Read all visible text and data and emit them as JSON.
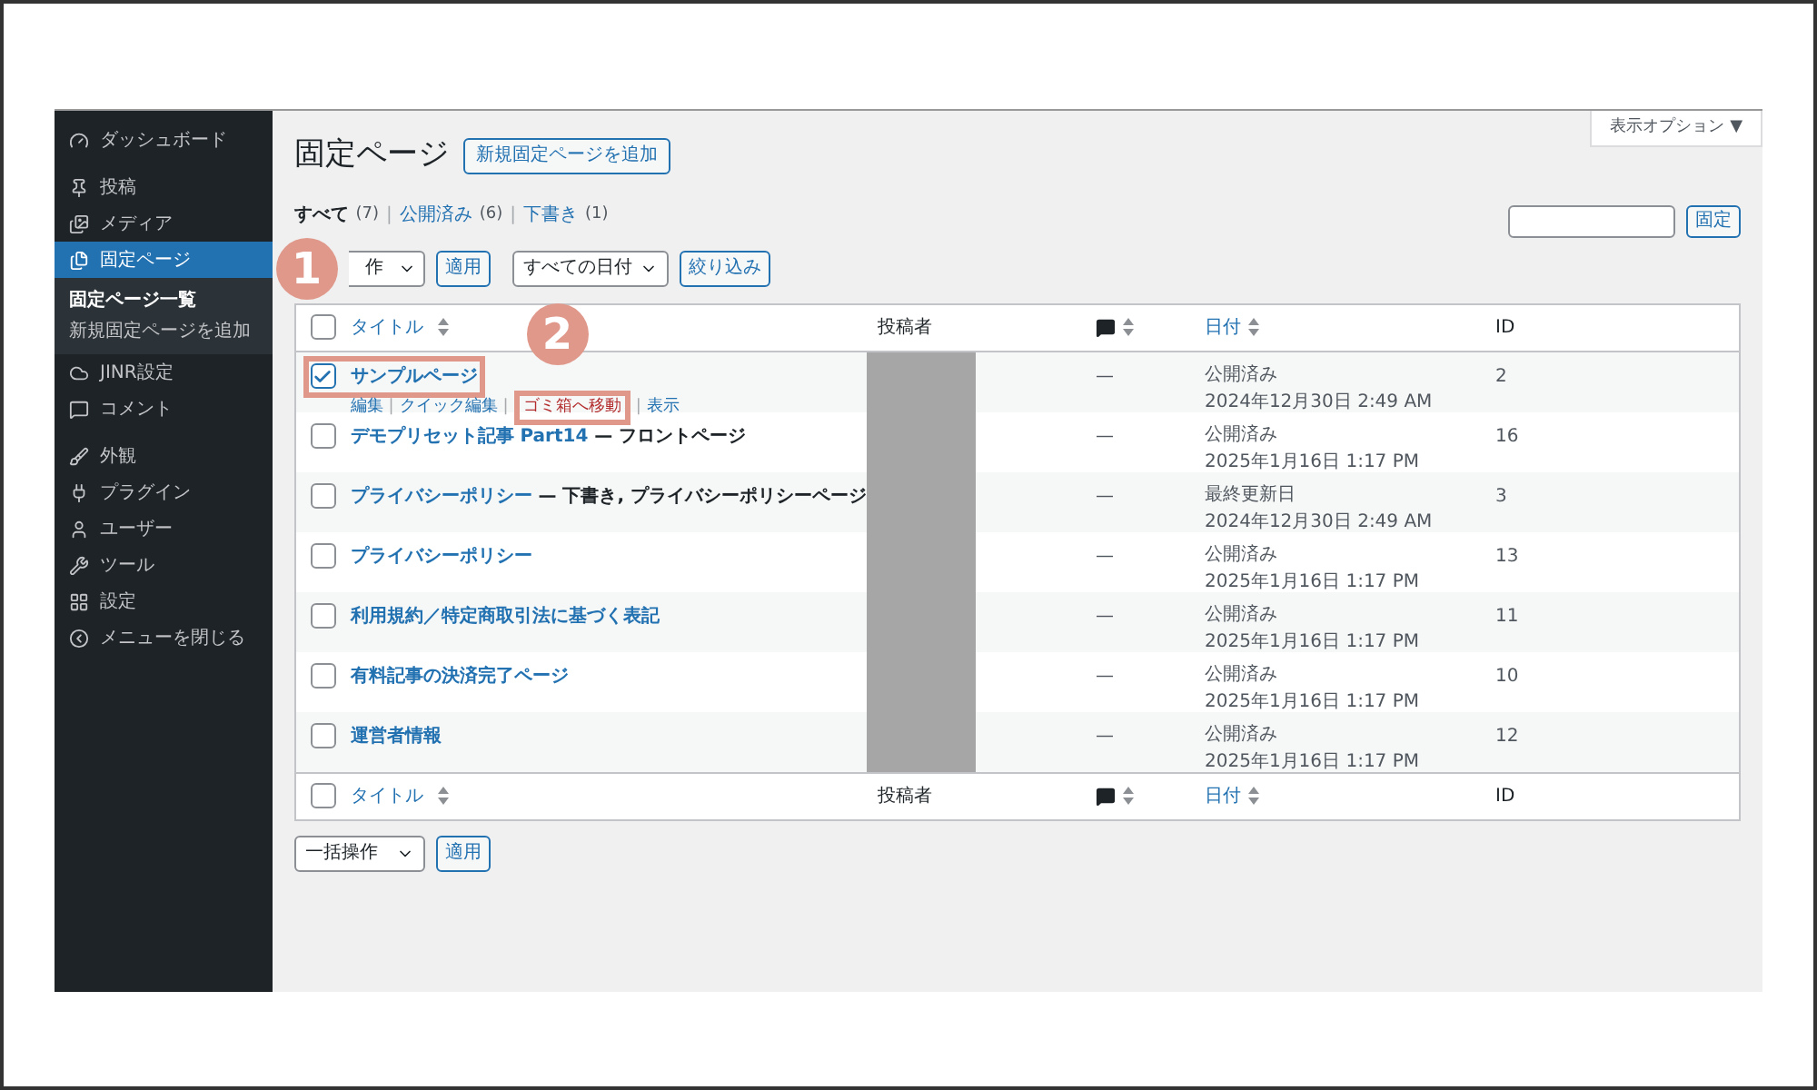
{
  "sidebar": {
    "items": [
      {
        "label": "ダッシュボード",
        "selected": false
      },
      {
        "label": "投稿",
        "selected": false
      },
      {
        "label": "メディア",
        "selected": false
      },
      {
        "label": "固定ページ",
        "selected": true,
        "children": [
          {
            "label": "固定ページ一覧",
            "selected": true
          },
          {
            "label": "新規固定ページを追加",
            "selected": false
          }
        ]
      },
      {
        "label": "JINR設定",
        "selected": false
      },
      {
        "label": "コメント",
        "selected": false
      },
      {
        "label": "外観",
        "selected": false
      },
      {
        "label": "プラグイン",
        "selected": false
      },
      {
        "label": "ユーザー",
        "selected": false
      },
      {
        "label": "ツール",
        "selected": false
      },
      {
        "label": "設定",
        "selected": false
      },
      {
        "label": "メニューを閉じる",
        "selected": false
      }
    ]
  },
  "screen_options": "表示オプション ▼",
  "page": {
    "title": "固定ページ",
    "add_button": "新規固定ページを追加"
  },
  "views": [
    {
      "label": "すべて",
      "count": "(7)",
      "selected": true
    },
    {
      "separator": "|",
      "label": "公開済み",
      "count": "(6)",
      "selected": false
    },
    {
      "separator": "|",
      "label": "下書き",
      "count": "(1)",
      "selected": false
    }
  ],
  "search": {
    "button": "固定"
  },
  "top_nav": {
    "bulk_action": "作",
    "apply": "適用",
    "date_filter": "すべての日付",
    "filter": "絞り込み"
  },
  "table": {
    "header": {
      "checked": false,
      "title": "タイトル",
      "author": "投稿者",
      "date": "日付",
      "id": "ID"
    },
    "footer": {
      "checked": false,
      "title": "タイトル",
      "author": "投稿者",
      "date": "日付",
      "id": "ID"
    },
    "rows": [
      {
        "title": "サンプルページ",
        "checked": true,
        "highlighted": true,
        "actions": [
          {
            "label": "編集",
            "kind": "link"
          },
          {
            "separator": "|",
            "label": "クイック編集",
            "kind": "link"
          },
          {
            "separator": "|",
            "label": "ゴミ箱へ移動",
            "kind": "trash",
            "highlighted": true
          },
          {
            "separator": "|",
            "label": "表示",
            "kind": "link"
          }
        ],
        "comments": "—",
        "status": "公開済み",
        "date": "2024年12月30日 2:49 AM",
        "id": "2"
      },
      {
        "title": "デモプリセット記事 Part14",
        "suffix": " — フロントページ",
        "checked": false,
        "comments": "—",
        "status": "公開済み",
        "date": "2025年1月16日 1:17 PM",
        "id": "16"
      },
      {
        "title": "プライバシーポリシー",
        "suffix": " — 下書き, プライバシーポリシーページ",
        "checked": false,
        "comments": "—",
        "status": "最終更新日",
        "date": "2024年12月30日 2:49 AM",
        "id": "3"
      },
      {
        "title": "プライバシーポリシー",
        "checked": false,
        "comments": "—",
        "status": "公開済み",
        "date": "2025年1月16日 1:17 PM",
        "id": "13"
      },
      {
        "title": "利用規約／特定商取引法に基づく表記",
        "checked": false,
        "comments": "—",
        "status": "公開済み",
        "date": "2025年1月16日 1:17 PM",
        "id": "11"
      },
      {
        "title": "有料記事の決済完了ページ",
        "checked": false,
        "comments": "—",
        "status": "公開済み",
        "date": "2025年1月16日 1:17 PM",
        "id": "10"
      },
      {
        "title": "運営者情報",
        "checked": false,
        "comments": "—",
        "status": "公開済み",
        "date": "2025年1月16日 1:17 PM",
        "id": "12"
      }
    ]
  },
  "bottom_nav": {
    "bulk_action": "一括操作",
    "apply": "適用"
  },
  "annotations": [
    {
      "label": "1"
    },
    {
      "label": "2"
    }
  ]
}
